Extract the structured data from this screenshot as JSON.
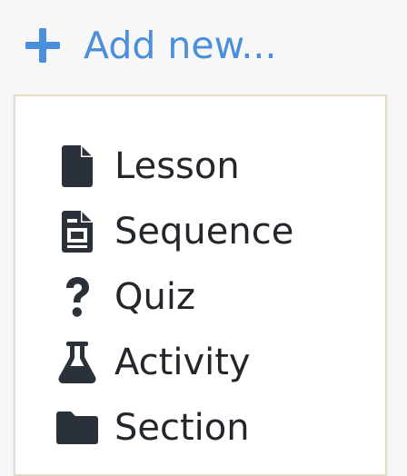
{
  "header": {
    "add_new_label": "Add new...",
    "add_icon": "plus-icon"
  },
  "colors": {
    "accent": "#4a8fdc",
    "text": "#23272b",
    "icon": "#2b3138",
    "menu_border": "#e4dcc4",
    "background": "#f7f7f8"
  },
  "menu": {
    "items": [
      {
        "label": "Lesson",
        "icon": "file-icon"
      },
      {
        "label": "Sequence",
        "icon": "file-list-icon"
      },
      {
        "label": "Quiz",
        "icon": "question-icon"
      },
      {
        "label": "Activity",
        "icon": "flask-icon"
      },
      {
        "label": "Section",
        "icon": "folder-icon"
      }
    ]
  }
}
